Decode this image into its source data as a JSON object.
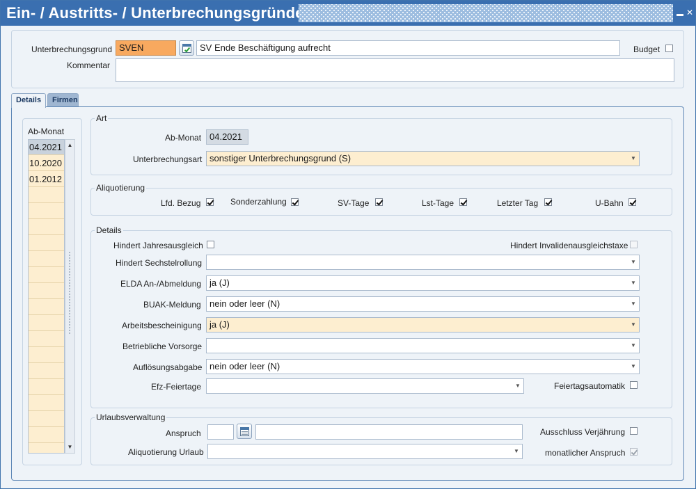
{
  "window": {
    "title": "Ein- / Austritts- / Unterbrechungsgründe"
  },
  "header": {
    "reason_label": "Unterbrechungsgrund",
    "reason_code": "SVEN",
    "reason_text": "SV Ende Beschäftigung aufrecht",
    "budget_label": "Budget",
    "budget_checked": false,
    "comment_label": "Kommentar",
    "comment_value": ""
  },
  "tabs": [
    {
      "label": "Details",
      "active": true
    },
    {
      "label": "Firmen",
      "active": false
    }
  ],
  "months": {
    "header": "Ab-Monat",
    "items": [
      "04.2021",
      "10.2020",
      "01.2012"
    ],
    "selected_index": 0
  },
  "art": {
    "legend": "Art",
    "ab_monat_label": "Ab-Monat",
    "ab_monat_value": "04.2021",
    "unterbrechungsart_label": "Unterbrechungsart",
    "unterbrechungsart_value": "sonstiger Unterbrechungsgrund (S)"
  },
  "aliquotierung": {
    "legend": "Aliquotierung",
    "items": [
      {
        "label": "Lfd. Bezug",
        "checked": true
      },
      {
        "label": "Sonderzahlung",
        "checked": true
      },
      {
        "label": "SV-Tage",
        "checked": true
      },
      {
        "label": "Lst-Tage",
        "checked": true
      },
      {
        "label": "Letzter Tag",
        "checked": true
      },
      {
        "label": "U-Bahn",
        "checked": true
      }
    ]
  },
  "details": {
    "legend": "Details",
    "jahresausgleich_label": "Hindert Jahresausgleich",
    "jahresausgleich_checked": false,
    "invalidenausgleichstaxe_label": "Hindert Invalidenausgleichstaxe",
    "invalidenausgleichstaxe_checked": false,
    "sechstelrollung_label": "Hindert Sechstelrollung",
    "sechstelrollung_value": "",
    "elda_label": "ELDA An-/Abmeldung",
    "elda_value": "ja (J)",
    "buak_label": "BUAK-Meldung",
    "buak_value": "nein oder leer (N)",
    "arbeitsbescheinigung_label": "Arbeitsbescheinigung",
    "arbeitsbescheinigung_value": "ja (J)",
    "vorsorge_label": "Betriebliche Vorsorge",
    "vorsorge_value": "",
    "aufloesungsabgabe_label": "Auflösungsabgabe",
    "aufloesungsabgabe_value": "nein oder leer (N)",
    "efz_label": "Efz-Feiertage",
    "efz_value": "",
    "feiertagsautomatik_label": "Feiertagsautomatik",
    "feiertagsautomatik_checked": false
  },
  "urlaub": {
    "legend": "Urlaubsverwaltung",
    "anspruch_label": "Anspruch",
    "anspruch_value": "",
    "anspruch_text": "",
    "verjaehrung_label": "Ausschluss Verjährung",
    "verjaehrung_checked": false,
    "aliquotierung_label": "Aliquotierung Urlaub",
    "aliquotierung_value": "",
    "monatlich_label": "monatlicher Anspruch",
    "monatlich_checked": true
  },
  "colors": {
    "titlebar": "#3a6fb0",
    "required_field": "#f8a95f",
    "highlight_field": "#fdeed0"
  }
}
